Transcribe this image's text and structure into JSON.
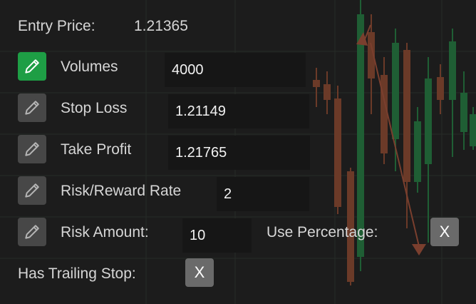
{
  "entry": {
    "label": "Entry Price:",
    "value": "1.21365"
  },
  "rows": [
    {
      "label": "Volumes",
      "value": "4000",
      "editing": true
    },
    {
      "label": "Stop Loss",
      "value": "1.21149",
      "editing": false
    },
    {
      "label": "Take Profit",
      "value": "1.21765",
      "editing": false
    },
    {
      "label": "Risk/Reward Rate",
      "value": "2",
      "editing": false
    },
    {
      "label": "Risk Amount:",
      "value": "10",
      "editing": false
    }
  ],
  "use_percentage": {
    "label": "Use Percentage:",
    "toggle": "X"
  },
  "trailing_stop": {
    "label": "Has Trailing Stop:",
    "toggle": "X"
  },
  "icons": {
    "edit": "pencil-icon"
  },
  "colors": {
    "active_edit": "#1e9e45",
    "inactive_edit": "#474747",
    "bull_candle": "#1f5e34",
    "bear_candle": "#6b3a28"
  }
}
